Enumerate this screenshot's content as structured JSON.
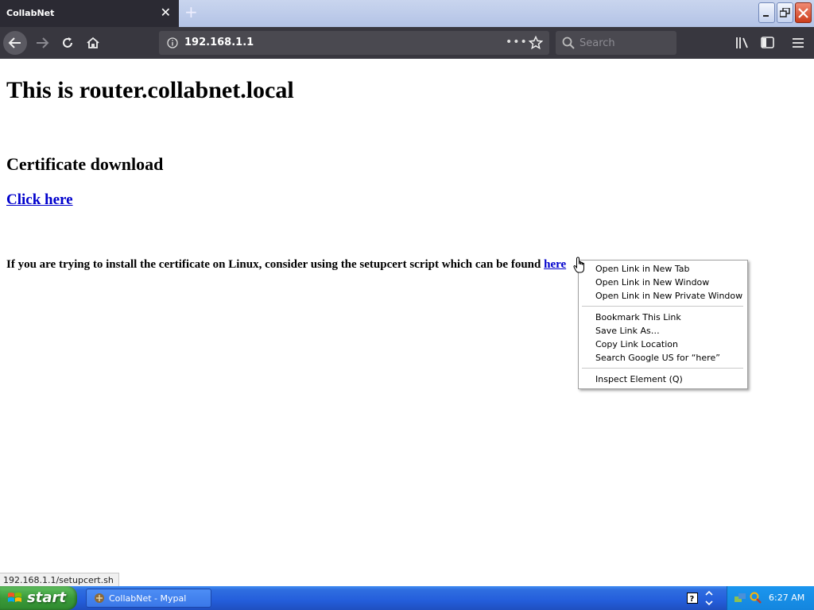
{
  "browser": {
    "tab_title": "CollabNet",
    "url": "192.168.1.1",
    "search_placeholder": "Search",
    "status_url": "192.168.1.1/setupcert.sh"
  },
  "page": {
    "heading": "This is router.collabnet.local",
    "subheading": "Certificate download",
    "download_link": "Click here",
    "linux_text": "If you are trying to install the certificate on Linux, consider using the setupcert script which can be found ",
    "here_link": "here"
  },
  "context_menu": {
    "items": [
      "Open Link in New Tab",
      "Open Link in New Window",
      "Open Link in New Private Window",
      "Bookmark This Link",
      "Save Link As…",
      "Copy Link Location",
      "Search Google US for “here”",
      "Inspect Element (Q)"
    ]
  },
  "taskbar": {
    "start_label": "start",
    "task_label": "CollabNet - Mypal",
    "clock": "6:27 AM"
  },
  "colors": {
    "toolbar": "#38373f",
    "link": "#0000cc",
    "taskbar": "#245edb",
    "start": "#3a9a3a"
  },
  "icons": [
    "back-arrow-icon",
    "forward-arrow-icon",
    "reload-icon",
    "home-icon",
    "info-icon",
    "more-icon",
    "star-icon",
    "search-icon",
    "library-icon",
    "sidebar-icon",
    "hamburger-menu-icon",
    "windows-logo-icon",
    "browser-app-icon",
    "help-icon",
    "tray-arrow-icon",
    "network-icon",
    "search-tray-icon",
    "hand-cursor-icon"
  ]
}
